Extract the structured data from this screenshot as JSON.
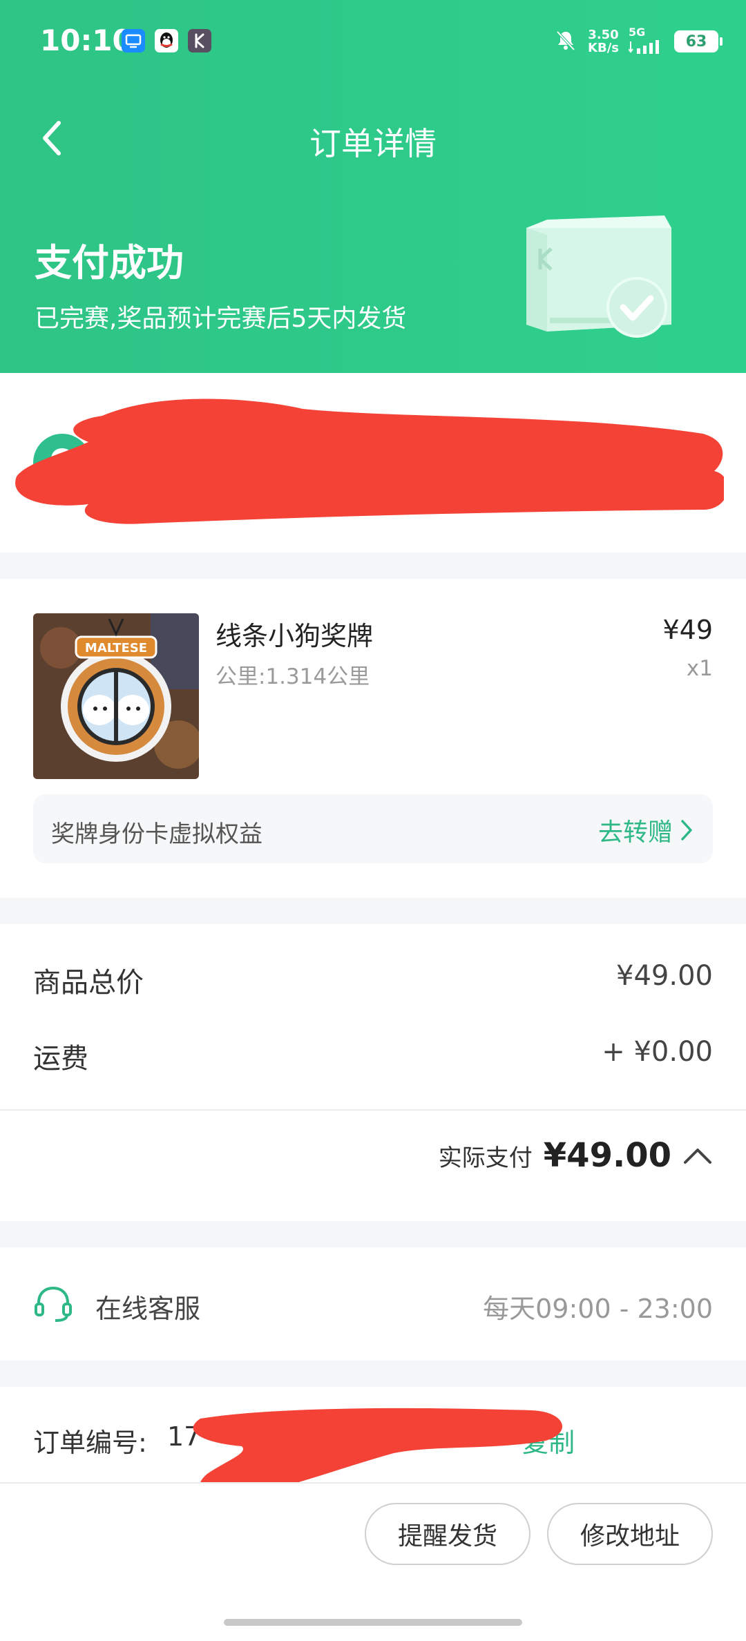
{
  "status_bar": {
    "time": "10:10",
    "speed_value": "3.50",
    "speed_unit": "KB/s",
    "network": "5G",
    "battery": "63"
  },
  "nav": {
    "title": "订单详情"
  },
  "payment": {
    "title": "支付成功",
    "subtitle": "已完赛,奖品预计完赛后5天内发货"
  },
  "product": {
    "name": "线条小狗奖牌",
    "spec": "公里:1.314公里",
    "price": "¥49",
    "quantity": "x1",
    "medal_text": "MALTESE",
    "benefit_label": "奖牌身份卡虚拟权益",
    "benefit_action": "去转赠"
  },
  "price_summary": {
    "subtotal_label": "商品总价",
    "subtotal_value": "¥49.00",
    "shipping_label": "运费",
    "shipping_value": "+ ¥0.00",
    "actual_label": "实际支付",
    "actual_value": "¥49.00"
  },
  "service": {
    "label": "在线客服",
    "hours": "每天09:00 - 23:00"
  },
  "order": {
    "label": "订单编号:",
    "number_prefix": "17",
    "copy": "复制"
  },
  "actions": {
    "remind": "提醒发货",
    "change_address": "修改地址"
  },
  "colors": {
    "brand_green": "#2fcb8a",
    "accent_text": "#2eb886",
    "redaction": "#f44336"
  }
}
